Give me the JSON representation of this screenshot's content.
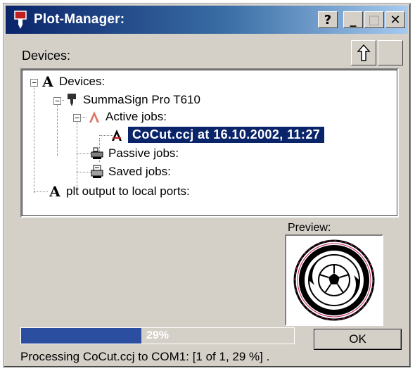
{
  "window": {
    "title": "Plot-Manager:",
    "buttons": {
      "help": "?",
      "minimize": "_",
      "maximize": "□",
      "close": "✕"
    }
  },
  "devices_label": "Devices:",
  "toolbar": {
    "up_icon": "up-arrow-icon",
    "blank_icon": "blank-icon"
  },
  "tree": {
    "root": {
      "label": "Devices:",
      "expander": "−"
    },
    "device": {
      "label": "SummaSign Pro T610",
      "expander": "−"
    },
    "active_jobs": {
      "label": "Active jobs:",
      "expander": "−"
    },
    "active_job_item": {
      "label": "CoCut.ccj at 16.10.2002, 11:27",
      "selected": true
    },
    "passive_jobs": {
      "label": "Passive jobs:"
    },
    "saved_jobs": {
      "label": "Saved jobs:"
    },
    "plt_output": {
      "label": "plt output to local ports:"
    }
  },
  "preview": {
    "label": "Preview:"
  },
  "progress": {
    "percent": 29,
    "text": "29%"
  },
  "ok_button": {
    "label": "OK"
  },
  "status": {
    "text": "Processing CoCut.ccj to COM1: [1 of 1, 29 %] ."
  },
  "colors": {
    "titlebar_start": "#0a246a",
    "titlebar_end": "#a6caf0",
    "selection": "#0a246a",
    "progress_fill": "#2c4ea0",
    "dialog_face": "#d4d0c8"
  }
}
